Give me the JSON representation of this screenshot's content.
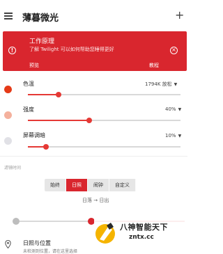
{
  "app": {
    "title": "薄暮微光",
    "add_label": "+"
  },
  "card": {
    "title": "工作原理",
    "subtitle": "了解 Twilight 可以如何帮助您睡得更好",
    "button_preview": "预览",
    "button_tutorial": "教程",
    "info_glyph": "!",
    "close_glyph": "×"
  },
  "settings": {
    "color_temp": {
      "label": "色温",
      "value": "1794K 放松",
      "level": 0.2,
      "dot_color": "#e53a17"
    },
    "intensity": {
      "label": "强度",
      "value": "40%",
      "level": 0.4,
      "dot_color": "#f4b19d"
    },
    "dim": {
      "label": "屏幕调暗",
      "value": "10%",
      "level": 0.12,
      "dot_color": "#e1e1e6"
    }
  },
  "schedule": {
    "section_label": "滤镜时间",
    "options": [
      "始终",
      "日照",
      "闹钟",
      "自定义"
    ],
    "selected": "日照",
    "sun_text": "日落 → 日出"
  },
  "location": {
    "title": "日照与位置",
    "subtitle": "未检测到位置，请在这里选择"
  },
  "watermark": {
    "line1": "八神智能天下",
    "line2": "zntx.cc"
  },
  "colors": {
    "accent": "#d9262e",
    "slider": "#e53935"
  }
}
